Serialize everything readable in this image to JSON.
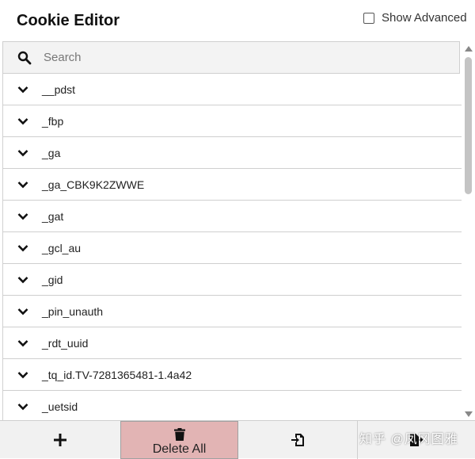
{
  "header": {
    "title": "Cookie Editor",
    "show_advanced_label": "Show Advanced",
    "show_advanced_checked": false
  },
  "search": {
    "placeholder": "Search",
    "value": ""
  },
  "cookies": [
    "__pdst",
    "_fbp",
    "_ga",
    "_ga_CBK9K2ZWWE",
    "_gat",
    "_gcl_au",
    "_gid",
    "_pin_unauth",
    "_rdt_uuid",
    "_tq_id.TV-7281365481-1.4a42",
    "_uetsid"
  ],
  "footer": {
    "add_icon": "plus-icon",
    "delete_all_label": "Delete All",
    "delete_icon": "trash-icon",
    "import_icon": "import-icon",
    "export_icon": "export-icon",
    "delete_bg_color": "#e2b4b4"
  },
  "watermark": "知乎 @凤冈图雅"
}
